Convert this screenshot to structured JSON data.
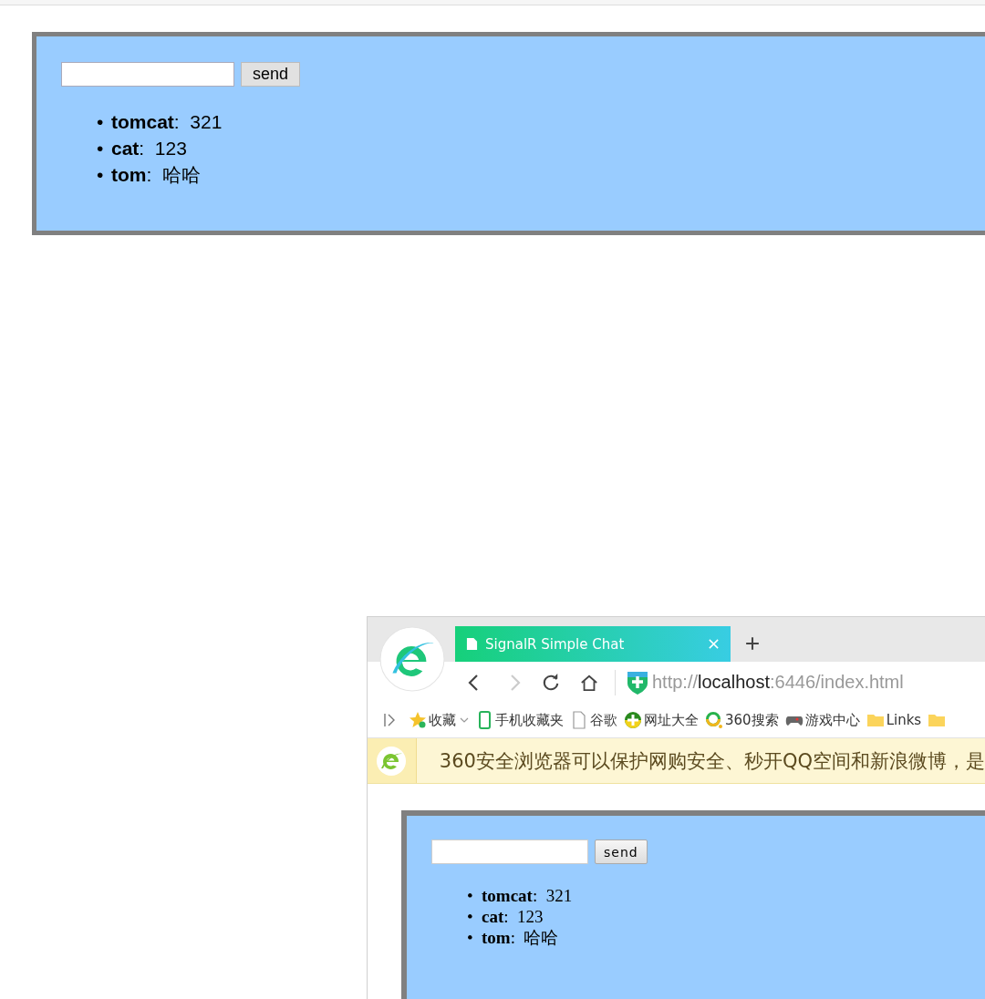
{
  "top_page": {
    "send_label": "send",
    "messages": [
      {
        "marker": "•",
        "text": "**tomcat**:  321"
      },
      {
        "marker": "•",
        "text": "**cat**:  123"
      },
      {
        "marker": "•",
        "text": "**tom**:  哈哈"
      }
    ]
  },
  "browser": {
    "tab": {
      "title": "SignalR Simple Chat",
      "selected": true
    },
    "address": {
      "scheme": "http://",
      "host": "localhost",
      "rest": ":6446/index.html"
    },
    "bookmarks": [
      {
        "kind": "star",
        "label": "收藏"
      },
      {
        "kind": "phone",
        "label": "手机收藏夹"
      },
      {
        "kind": "page",
        "label": "谷歌"
      },
      {
        "kind": "plus",
        "label": "网址大全"
      },
      {
        "kind": "ring",
        "label": "360搜索"
      },
      {
        "kind": "gamepad",
        "label": "游戏中心"
      },
      {
        "kind": "folder",
        "label": "Links"
      },
      {
        "kind": "folder"
      }
    ],
    "notice": "360安全浏览器可以保护网购安全、秒开QQ空间和新浪微博，是",
    "page": {
      "send_label": "send",
      "messages": [
        {
          "marker": "•",
          "text": "**tomcat**:  321"
        },
        {
          "marker": "•",
          "text": "**cat**:  123"
        },
        {
          "marker": "•",
          "text": "**tom**:  哈哈"
        }
      ]
    }
  }
}
